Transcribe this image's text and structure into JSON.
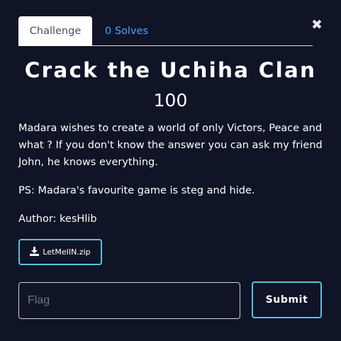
{
  "modal": {
    "close_glyph": "✖"
  },
  "tabs": [
    {
      "label": "Challenge",
      "active": true
    },
    {
      "label": "0 Solves",
      "active": false
    }
  ],
  "challenge": {
    "title": "Crack the Uchiha Clan",
    "value": "100",
    "description": [
      "Madara wishes to create a world of only Victors, Peace and what ? If you don't know the answer you can ask my friend John, he knows everything.",
      "PS: Madara's favourite game is steg and hide.",
      "Author: kesHlib"
    ],
    "file": {
      "label": "LetMeIIN.zip",
      "icon": "download-icon"
    }
  },
  "flag": {
    "placeholder": "Flag",
    "value": ""
  },
  "submit": {
    "label": "Submit"
  },
  "colors": {
    "background": "#0f1426",
    "accent": "#5bc0de",
    "link": "#4aa3ff",
    "tab_active_bg": "#ffffff",
    "tab_active_text": "#495057"
  }
}
